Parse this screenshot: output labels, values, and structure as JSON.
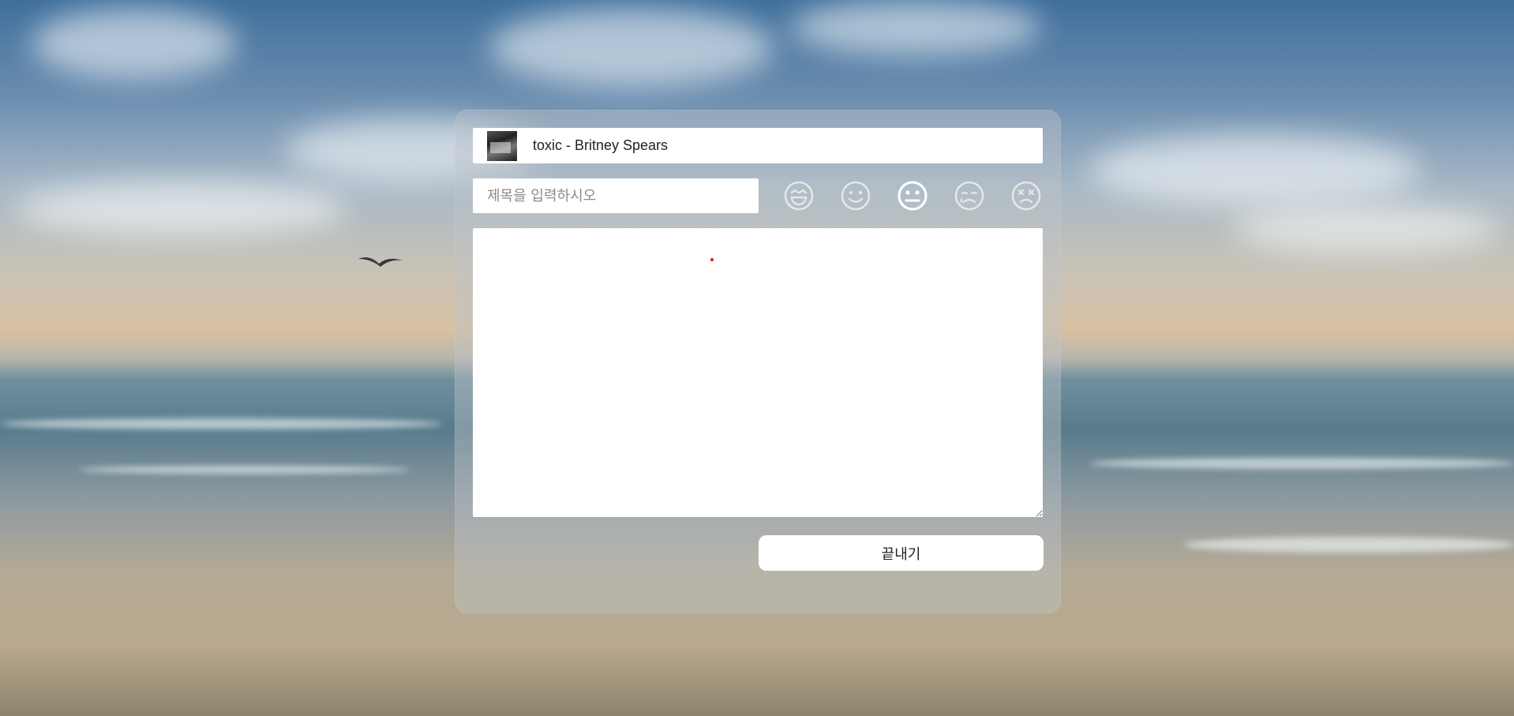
{
  "song": {
    "label": "toxic - Britney Spears",
    "art_icon": "album-art"
  },
  "entry": {
    "title_placeholder": "제목을 입력하시오",
    "title_value": "",
    "memo_value": ""
  },
  "moods": [
    {
      "icon": "laughing-face-icon",
      "selected": false
    },
    {
      "icon": "smiling-face-icon",
      "selected": false
    },
    {
      "icon": "neutral-face-icon",
      "selected": true
    },
    {
      "icon": "crying-face-icon",
      "selected": false
    },
    {
      "icon": "dizzy-face-icon",
      "selected": false
    }
  ],
  "actions": {
    "finish_label": "끝내기"
  },
  "colors": {
    "panel_overlay": "rgba(190,196,200,0.42)",
    "icon_muted": "#e6e6e6",
    "icon_selected": "#ffffff",
    "cursor_dot": "#e01919"
  }
}
